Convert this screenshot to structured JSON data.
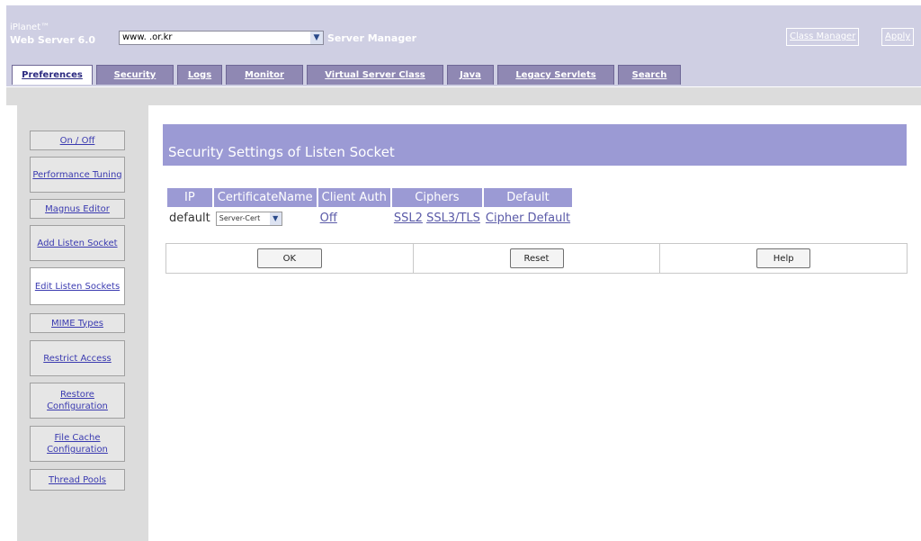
{
  "brand": {
    "line1": "iPlanet™",
    "line2": "Web Server 6.0"
  },
  "server_select": {
    "value": "www.      .or.kr"
  },
  "header_title": "Server Manager",
  "top_links": {
    "class_manager": "Class Manager",
    "apply": "Apply"
  },
  "tabs": [
    {
      "label": "Preferences",
      "active": true
    },
    {
      "label": "Security"
    },
    {
      "label": "Logs"
    },
    {
      "label": "Monitor"
    },
    {
      "label": "Virtual Server Class"
    },
    {
      "label": "Java"
    },
    {
      "label": "Legacy Servlets"
    },
    {
      "label": "Search"
    }
  ],
  "sidebar": {
    "items": [
      {
        "label": "On / Off"
      },
      {
        "label": "Performance Tuning"
      },
      {
        "label": "Magnus Editor"
      },
      {
        "label": "Add Listen Socket"
      },
      {
        "label": "Edit Listen Sockets",
        "active": true
      },
      {
        "label": "MIME Types"
      },
      {
        "label": "Restrict Access"
      },
      {
        "label": "Restore Configuration"
      },
      {
        "label": "File Cache Configuration"
      },
      {
        "label": "Thread Pools"
      }
    ]
  },
  "main": {
    "title": "Security Settings of Listen Socket",
    "table": {
      "headers": [
        "IP",
        "CertificateName",
        "Client Auth",
        "Ciphers",
        "Default"
      ],
      "row": {
        "ip": "default",
        "certificate": "Server-Cert",
        "client_auth": "Off",
        "cipher_ssl2": "SSL2",
        "cipher_ssl3": "SSL3/TLS",
        "default": "Cipher Default"
      }
    },
    "buttons": {
      "ok": "OK",
      "reset": "Reset",
      "help": "Help"
    }
  }
}
